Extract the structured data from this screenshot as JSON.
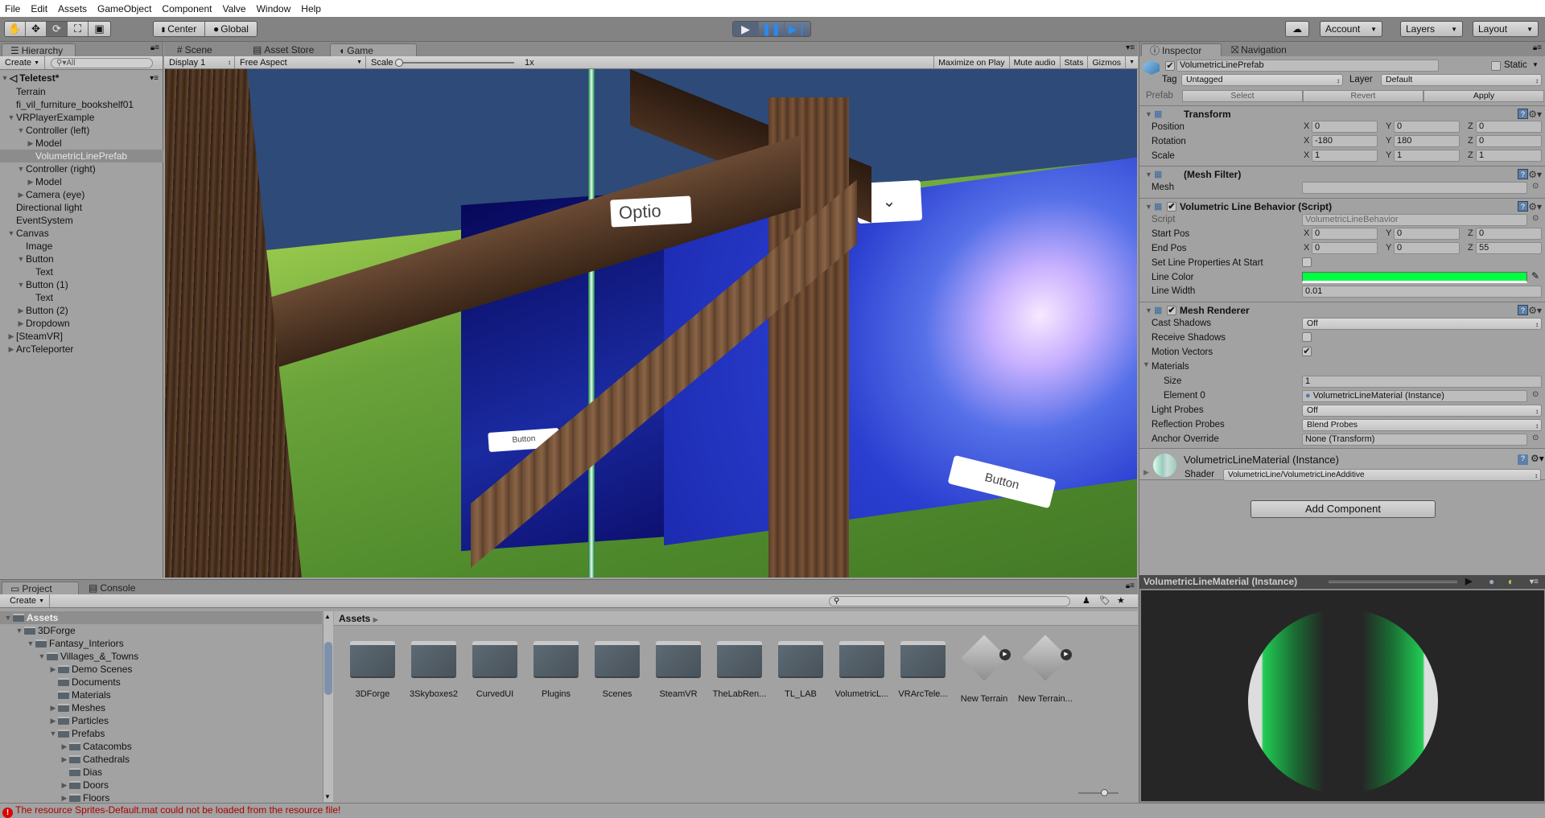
{
  "menu": [
    "File",
    "Edit",
    "Assets",
    "GameObject",
    "Component",
    "Valve",
    "Window",
    "Help"
  ],
  "toolbar": {
    "tools": [
      "hand-tool",
      "move-tool",
      "rotate-tool",
      "scale-tool",
      "rect-tool"
    ],
    "pivot": "Center",
    "space": "Global",
    "account": "Account",
    "layers": "Layers",
    "layout": "Layout"
  },
  "hierarchy": {
    "tab": "Hierarchy",
    "create": "Create",
    "search_placeholder": "All",
    "scene": "Teletest*",
    "items": [
      {
        "label": "Terrain",
        "depth": 1,
        "arrow": ""
      },
      {
        "label": "fi_vil_furniture_bookshelf01",
        "depth": 1,
        "arrow": ""
      },
      {
        "label": "VRPlayerExample",
        "depth": 1,
        "arrow": "down"
      },
      {
        "label": "Controller (left)",
        "depth": 2,
        "arrow": "down"
      },
      {
        "label": "Model",
        "depth": 3,
        "arrow": "right"
      },
      {
        "label": "VolumetricLinePrefab",
        "depth": 3,
        "arrow": "",
        "selected": true
      },
      {
        "label": "Controller (right)",
        "depth": 2,
        "arrow": "down"
      },
      {
        "label": "Model",
        "depth": 3,
        "arrow": "right"
      },
      {
        "label": "Camera (eye)",
        "depth": 2,
        "arrow": "right"
      },
      {
        "label": "Directional light",
        "depth": 1,
        "arrow": ""
      },
      {
        "label": "EventSystem",
        "depth": 1,
        "arrow": ""
      },
      {
        "label": "Canvas",
        "depth": 1,
        "arrow": "down"
      },
      {
        "label": "Image",
        "depth": 2,
        "arrow": ""
      },
      {
        "label": "Button",
        "depth": 2,
        "arrow": "down"
      },
      {
        "label": "Text",
        "depth": 3,
        "arrow": ""
      },
      {
        "label": "Button (1)",
        "depth": 2,
        "arrow": "down"
      },
      {
        "label": "Text",
        "depth": 3,
        "arrow": ""
      },
      {
        "label": "Button (2)",
        "depth": 2,
        "arrow": "right"
      },
      {
        "label": "Dropdown",
        "depth": 2,
        "arrow": "right"
      },
      {
        "label": "[SteamVR]",
        "depth": 1,
        "arrow": "right"
      },
      {
        "label": "ArcTeleporter",
        "depth": 1,
        "arrow": "right"
      }
    ]
  },
  "center_tabs": [
    "Scene",
    "Asset Store",
    "Game"
  ],
  "game_toolbar": {
    "display": "Display 1",
    "aspect": "Free Aspect",
    "scale_label": "Scale",
    "scale_value": "1x",
    "scale_fraction": 0,
    "buttons": [
      "Maximize on Play",
      "Mute audio",
      "Stats",
      "Gizmos"
    ]
  },
  "game_view": {
    "dropdown_text": "Optio",
    "button_left": "Button",
    "button_right": "Button"
  },
  "inspector": {
    "tabs": [
      "Inspector",
      "Navigation"
    ],
    "object_name": "VolumetricLinePrefab",
    "active": true,
    "static_label": "Static",
    "tag_label": "Tag",
    "tag": "Untagged",
    "layer_label": "Layer",
    "layer": "Default",
    "prefab_label": "Prefab",
    "prefab_buttons": [
      "Select",
      "Revert",
      "Apply"
    ],
    "transform": {
      "title": "Transform",
      "position_label": "Position",
      "position": [
        "0",
        "0",
        "0"
      ],
      "rotation_label": "Rotation",
      "rotation": [
        "-180",
        "180",
        "0"
      ],
      "scale_label": "Scale",
      "scale": [
        "1",
        "1",
        "1"
      ]
    },
    "mesh_filter": {
      "title": "(Mesh Filter)",
      "mesh_label": "Mesh",
      "mesh": ""
    },
    "script": {
      "title": "Volumetric Line Behavior (Script)",
      "enabled": true,
      "script_label": "Script",
      "script": "VolumetricLineBehavior",
      "start_label": "Start Pos",
      "start": [
        "0",
        "0",
        "0"
      ],
      "end_label": "End Pos",
      "end": [
        "0",
        "0",
        "55"
      ],
      "set_props_label": "Set Line Properties At Start",
      "set_props": false,
      "color_label": "Line Color",
      "color": "#00ff40",
      "width_label": "Line Width",
      "width": "0.01"
    },
    "renderer": {
      "title": "Mesh Renderer",
      "enabled": true,
      "cast_label": "Cast Shadows",
      "cast": "Off",
      "receive_label": "Receive Shadows",
      "receive": false,
      "motion_label": "Motion Vectors",
      "motion": true,
      "materials_label": "Materials",
      "size_label": "Size",
      "size": "1",
      "element_label": "Element 0",
      "element": "VolumetricLineMaterial (Instance)",
      "light_label": "Light Probes",
      "light": "Off",
      "refl_label": "Reflection Probes",
      "refl": "Blend Probes",
      "anchor_label": "Anchor Override",
      "anchor": "None (Transform)"
    },
    "material": {
      "title": "VolumetricLineMaterial (Instance)",
      "shader_label": "Shader",
      "shader": "VolumetricLine/VolumetricLineAdditive"
    },
    "add_component": "Add Component",
    "axes": [
      "X",
      "Y",
      "Z"
    ]
  },
  "preview": {
    "title": "VolumetricLineMaterial (Instance)"
  },
  "project": {
    "tabs": [
      "Project",
      "Console"
    ],
    "create": "Create",
    "search_placeholder": "",
    "tree": [
      {
        "label": "Assets",
        "depth": 0,
        "arrow": "down",
        "selected": true
      },
      {
        "label": "3DForge",
        "depth": 1,
        "arrow": "down"
      },
      {
        "label": "Fantasy_Interiors",
        "depth": 2,
        "arrow": "down"
      },
      {
        "label": "Villages_&_Towns",
        "depth": 3,
        "arrow": "down"
      },
      {
        "label": "Demo Scenes",
        "depth": 4,
        "arrow": "right"
      },
      {
        "label": "Documents",
        "depth": 4,
        "arrow": ""
      },
      {
        "label": "Materials",
        "depth": 4,
        "arrow": ""
      },
      {
        "label": "Meshes",
        "depth": 4,
        "arrow": "right"
      },
      {
        "label": "Particles",
        "depth": 4,
        "arrow": "right"
      },
      {
        "label": "Prefabs",
        "depth": 4,
        "arrow": "down"
      },
      {
        "label": "Catacombs",
        "depth": 5,
        "arrow": "right"
      },
      {
        "label": "Cathedrals",
        "depth": 5,
        "arrow": "right"
      },
      {
        "label": "Dias",
        "depth": 5,
        "arrow": ""
      },
      {
        "label": "Doors",
        "depth": 5,
        "arrow": "right"
      },
      {
        "label": "Floors",
        "depth": 5,
        "arrow": "right"
      }
    ],
    "breadcrumb": "Assets",
    "assets": [
      {
        "label": "3DForge",
        "type": "folder"
      },
      {
        "label": "3Skyboxes2",
        "type": "folder"
      },
      {
        "label": "CurvedUI",
        "type": "folder"
      },
      {
        "label": "Plugins",
        "type": "folder"
      },
      {
        "label": "Scenes",
        "type": "folder"
      },
      {
        "label": "SteamVR",
        "type": "folder"
      },
      {
        "label": "TheLabRen...",
        "type": "folder"
      },
      {
        "label": "TL_LAB",
        "type": "folder"
      },
      {
        "label": "VolumetricL...",
        "type": "folder"
      },
      {
        "label": "VRArcTele...",
        "type": "folder"
      },
      {
        "label": "New Terrain",
        "type": "terrain"
      },
      {
        "label": "New Terrain...",
        "type": "terrain"
      }
    ]
  },
  "status": {
    "message": "The resource Sprites-Default.mat could not be loaded from the resource file!",
    "level": "error",
    "color": "#b00000"
  }
}
